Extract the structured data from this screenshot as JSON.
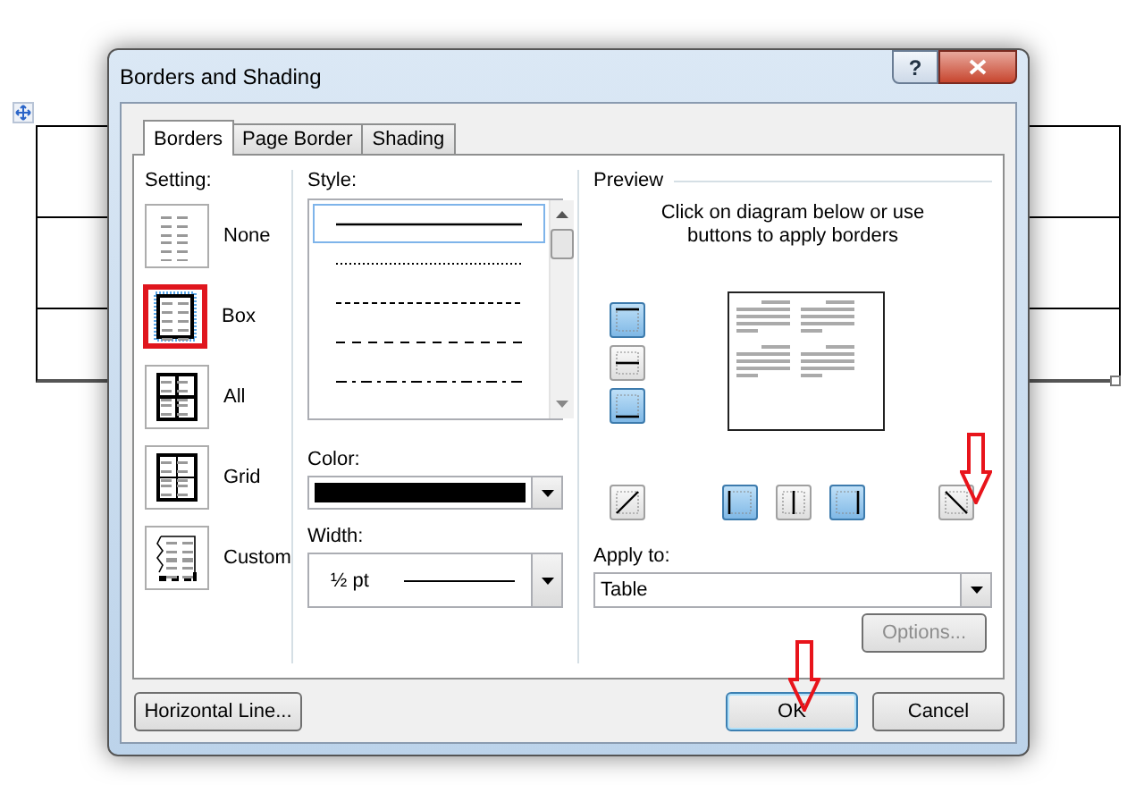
{
  "window": {
    "title": "Borders and Shading",
    "help": "?"
  },
  "tabs": [
    {
      "label": "Borders",
      "selected": true
    },
    {
      "label": "Page Border",
      "selected": false
    },
    {
      "label": "Shading",
      "selected": false
    }
  ],
  "setting": {
    "label": "Setting:",
    "options": [
      {
        "label": "None",
        "kind": "none",
        "selected": false
      },
      {
        "label": "Box",
        "kind": "box",
        "selected": true
      },
      {
        "label": "All",
        "kind": "all",
        "selected": false
      },
      {
        "label": "Grid",
        "kind": "grid",
        "selected": false
      },
      {
        "label": "Custom",
        "kind": "custom",
        "selected": false
      }
    ]
  },
  "style": {
    "label": "Style:",
    "lines": [
      {
        "kind": "solid",
        "selected": true
      },
      {
        "kind": "dotted",
        "selected": false
      },
      {
        "kind": "fine-dash",
        "selected": false
      },
      {
        "kind": "dashed",
        "selected": false
      },
      {
        "kind": "dash-dot",
        "selected": false
      }
    ]
  },
  "color": {
    "label": "Color:",
    "color": "#000000"
  },
  "width": {
    "label": "Width:",
    "value": "½ pt"
  },
  "preview": {
    "label": "Preview",
    "hint_lines": [
      "Click on diagram below or use",
      "buttons to apply borders"
    ],
    "side_buttons": [
      {
        "kind": "top",
        "on": true
      },
      {
        "kind": "inside-horizontal",
        "on": false
      },
      {
        "kind": "bottom",
        "on": true
      }
    ],
    "bottom_buttons": [
      {
        "kind": "diagonal-up",
        "on": false
      },
      {
        "kind": "left",
        "on": true
      },
      {
        "kind": "inside-vertical",
        "on": false
      },
      {
        "kind": "right",
        "on": true
      },
      {
        "kind": "diagonal-down",
        "on": false
      }
    ]
  },
  "apply_to": {
    "label": "Apply to:",
    "value": "Table"
  },
  "options_button": {
    "label": "Options...",
    "disabled": true
  },
  "horizontal_line_button": {
    "label": "Horizontal Line..."
  },
  "buttons": [
    {
      "label": "OK",
      "default": true
    },
    {
      "label": "Cancel",
      "default": false
    }
  ]
}
